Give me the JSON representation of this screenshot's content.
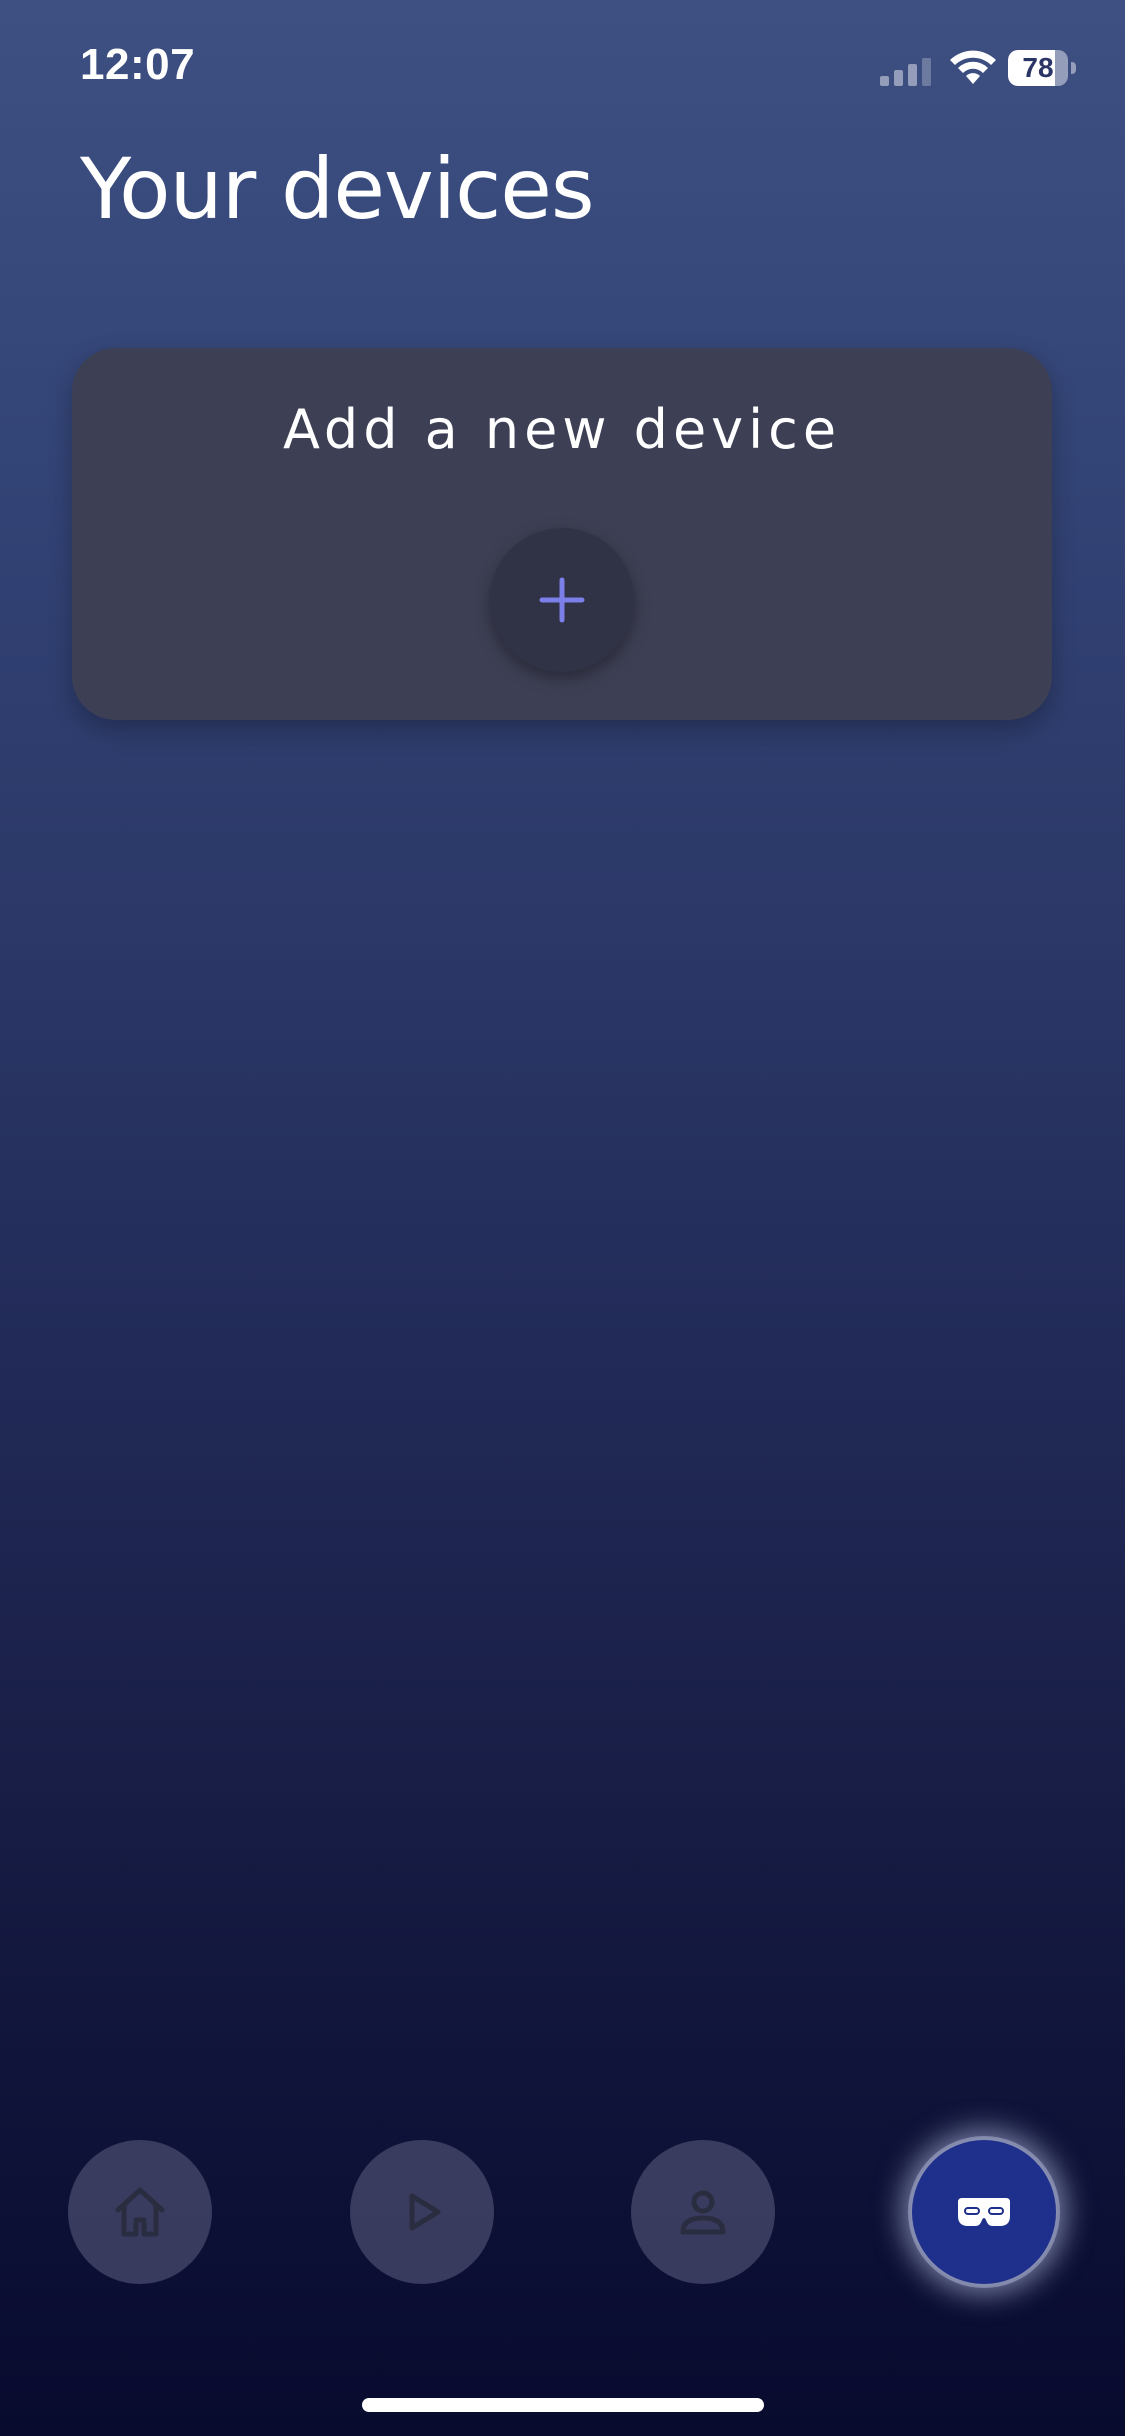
{
  "status_bar": {
    "time": "12:07",
    "battery_level": "78",
    "battery_fraction": 0.78,
    "icons": [
      "signal-icon",
      "wifi-icon",
      "battery-icon"
    ]
  },
  "page": {
    "title": "Your devices"
  },
  "add_device_card": {
    "title": "Add a new device",
    "button_icon": "plus-icon"
  },
  "bottom_nav": {
    "items": [
      {
        "name": "home",
        "icon": "home-icon",
        "active": false
      },
      {
        "name": "play",
        "icon": "play-icon",
        "active": false
      },
      {
        "name": "profile",
        "icon": "user-icon",
        "active": false
      },
      {
        "name": "devices",
        "icon": "vr-headset-icon",
        "active": true
      }
    ]
  },
  "colors": {
    "accent": "#7b7fe8",
    "active_nav": "#1f2f8c",
    "card": "#3d3f54"
  }
}
